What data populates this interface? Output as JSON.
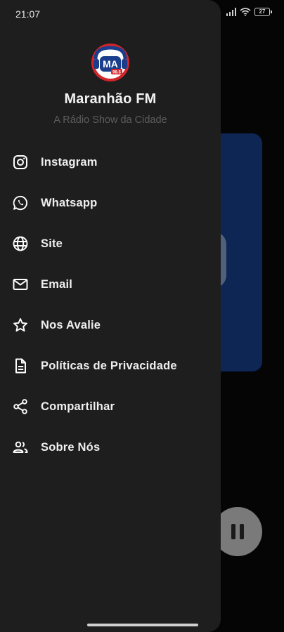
{
  "status_bar": {
    "time": "21:07",
    "battery": "27"
  },
  "drawer": {
    "title": "Maranhão FM",
    "subtitle": "A Rádio Show da Cidade",
    "logo": {
      "text": "MA",
      "subtext": "98.5",
      "colors": {
        "ring": "#d3262b",
        "badge": "#1a3e8c"
      }
    },
    "items": [
      {
        "label": "Instagram",
        "icon": "instagram-icon"
      },
      {
        "label": "Whatsapp",
        "icon": "whatsapp-icon"
      },
      {
        "label": "Site",
        "icon": "globe-icon"
      },
      {
        "label": "Email",
        "icon": "mail-icon"
      },
      {
        "label": "Nos Avalie",
        "icon": "star-icon"
      },
      {
        "label": "Políticas de Privacidade",
        "icon": "document-icon"
      },
      {
        "label": "Compartilhar",
        "icon": "share-icon"
      },
      {
        "label": "Sobre Nós",
        "icon": "people-icon"
      }
    ]
  },
  "player": {
    "state": "playing",
    "control_icon": "pause-icon"
  },
  "colors": {
    "drawer_bg": "#1e1e1e",
    "artwork_bg": "#0f2d63",
    "subtitle": "#5d5d5d"
  }
}
